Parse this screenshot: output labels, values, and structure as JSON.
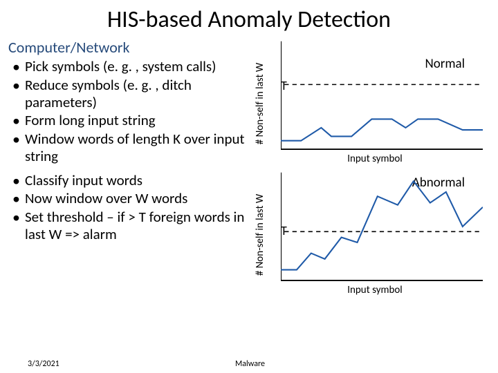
{
  "title": "HIS-based Anomaly Detection",
  "subheading": "Computer/Network",
  "bullets_a": [
    "Pick symbols (e. g. , system calls)",
    "Reduce symbols (e. g. , ditch parameters)",
    "Form long input string",
    "Window words of length K over input string"
  ],
  "bullets_b": [
    "Classify input words",
    "Now window over W words",
    "Set threshold – if > T foreign words in last W => alarm"
  ],
  "chart1": {
    "ylabel": "# Non-self in last W",
    "xlabel": "Input symbol",
    "label": "Normal",
    "threshold_label": "T"
  },
  "chart2": {
    "ylabel": "# Non-self in last W",
    "xlabel": "Input symbol",
    "label": "Abnormal",
    "threshold_label": "T"
  },
  "footer": {
    "date": "3/3/2021",
    "center": "Malware"
  },
  "chart_data": [
    {
      "type": "line",
      "title": "Normal",
      "ylabel": "# Non-self in last W",
      "xlabel": "Input symbol",
      "threshold": 60,
      "ylim": [
        0,
        100
      ],
      "series": [
        {
          "name": "signal",
          "x": [
            0,
            10,
            20,
            25,
            35,
            45,
            55,
            62,
            68,
            78,
            90,
            100
          ],
          "y": [
            8,
            8,
            20,
            12,
            12,
            28,
            28,
            20,
            28,
            28,
            18,
            18
          ]
        }
      ]
    },
    {
      "type": "line",
      "title": "Abnormal",
      "ylabel": "# Non-self in last W",
      "xlabel": "Input symbol",
      "threshold": 45,
      "ylim": [
        0,
        100
      ],
      "series": [
        {
          "name": "signal",
          "x": [
            0,
            8,
            15,
            22,
            30,
            38,
            48,
            58,
            66,
            74,
            82,
            90,
            100
          ],
          "y": [
            10,
            10,
            25,
            20,
            40,
            35,
            78,
            70,
            92,
            72,
            82,
            50,
            68
          ]
        }
      ]
    }
  ]
}
